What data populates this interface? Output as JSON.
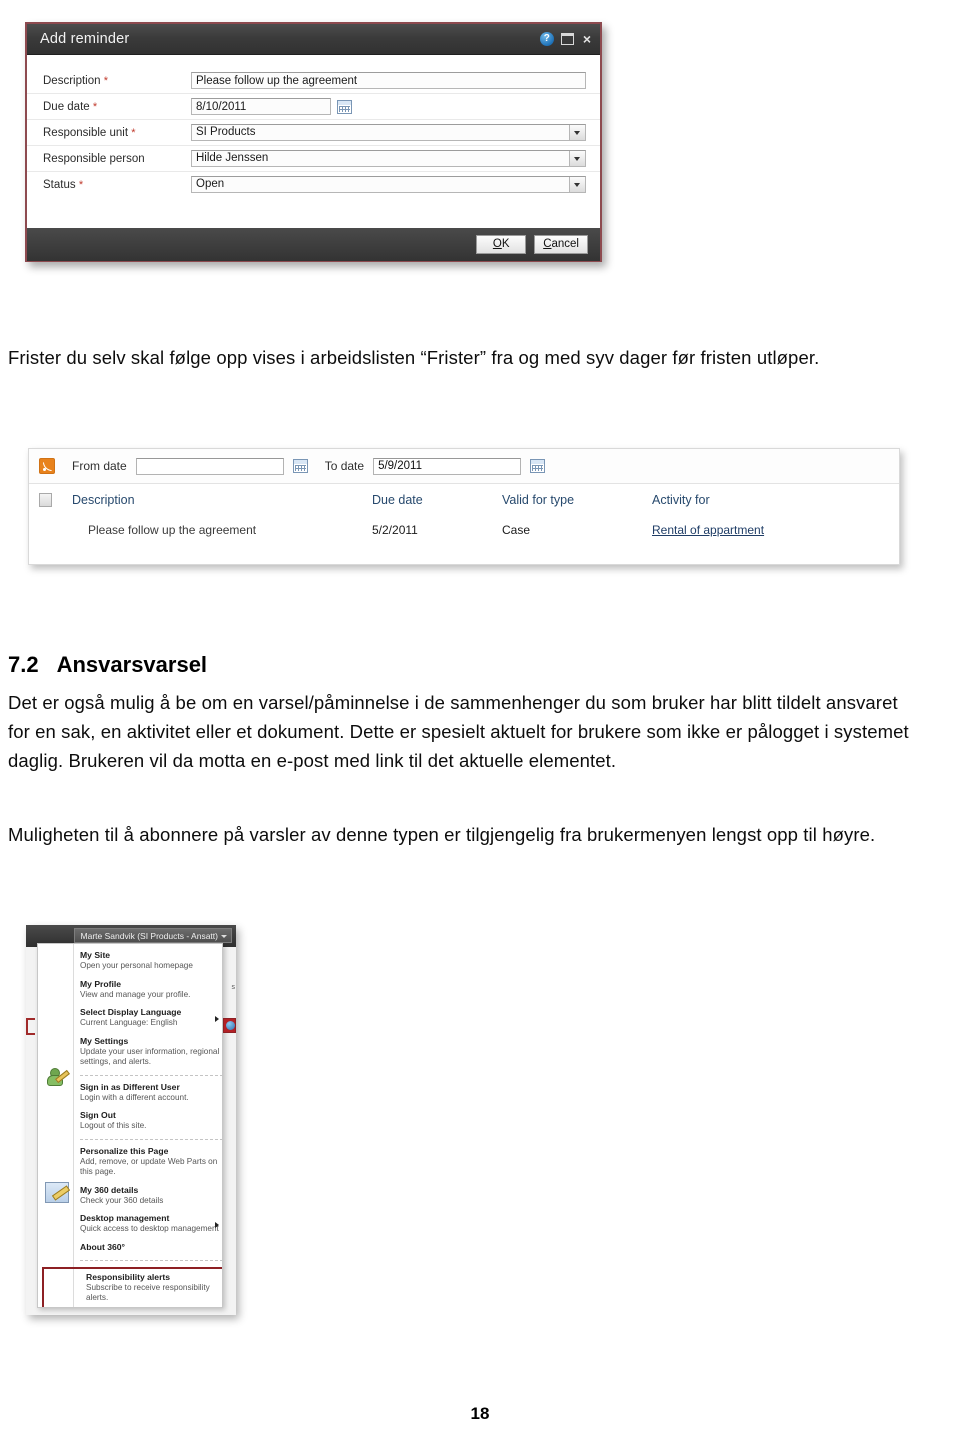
{
  "dialog": {
    "title": "Add reminder",
    "title_buttons": {
      "help": "?",
      "restore": "",
      "close": "×"
    },
    "fields": [
      {
        "label": "Description",
        "required": true,
        "value": "Please follow up the agreement",
        "control": "text"
      },
      {
        "label": "Due date",
        "required": true,
        "value": "8/10/2011",
        "control": "date"
      },
      {
        "label": "Responsible unit",
        "required": true,
        "value": "SI Products",
        "control": "combo"
      },
      {
        "label": "Responsible person",
        "required": false,
        "value": "Hilde Jenssen",
        "control": "combo"
      },
      {
        "label": "Status",
        "required": true,
        "value": "Open",
        "control": "combo"
      }
    ],
    "ok_label_pre": "O",
    "ok_label_accel": "K",
    "cancel_label_accel": "C",
    "cancel_label_post": "ancel"
  },
  "body_text": {
    "paragraph_1": "Frister du selv skal følge opp vises i arbeidslisten “Frister” fra og med syv dager før fristen utløper.",
    "section_number": "7.2",
    "section_title": "Ansvarsvarsel",
    "paragraph_2": "Det er også mulig å be om en varsel/påminnelse i de sammenhenger du som bruker har blitt tildelt ansvaret for en sak, en aktivitet eller et dokument. Dette er spesielt aktuelt for brukere som ikke er pålogget i systemet daglig. Brukeren vil da motta en e-post med link til det aktuelle elementet.",
    "paragraph_3": "Muligheten til å abonnere på varsler av denne typen er tilgjengelig fra brukermenyen lengst opp til høyre."
  },
  "reminder_list": {
    "filter": {
      "from_label": "From date",
      "from_value": "",
      "to_label": "To date",
      "to_value": "5/9/2011"
    },
    "columns": [
      "Description",
      "Due date",
      "Valid for type",
      "Activity for"
    ],
    "rows": [
      {
        "description": "Please follow up the agreement",
        "due_date": "5/2/2011",
        "valid_for_type": "Case",
        "activity_for": "Rental of appartment"
      }
    ]
  },
  "user_menu": {
    "user_button": "Marte Sandvik (SI Products - Ansatt)",
    "side_fragment": "s",
    "items": [
      {
        "title": "My Site",
        "desc": "Open your personal homepage",
        "arrow": false,
        "sep_before": false
      },
      {
        "title": "My Profile",
        "desc": "View and manage your profile.",
        "arrow": false,
        "sep_before": false
      },
      {
        "title": "Select Display Language",
        "desc": "Current Language: English",
        "arrow": true,
        "sep_before": false
      },
      {
        "title": "My Settings",
        "desc": "Update your user information, regional settings, and alerts.",
        "arrow": false,
        "sep_before": false
      },
      {
        "title": "Sign in as Different User",
        "desc": "Login with a different account.",
        "arrow": false,
        "sep_before": true
      },
      {
        "title": "Sign Out",
        "desc": "Logout of this site.",
        "arrow": false,
        "sep_before": false
      },
      {
        "title": "Personalize this Page",
        "desc": "Add, remove, or update Web Parts on this page.",
        "arrow": false,
        "sep_before": true
      },
      {
        "title": "My 360 details",
        "desc": "Check your 360 details",
        "arrow": false,
        "sep_before": false
      },
      {
        "title": "Desktop management",
        "desc": "Quick access to desktop management",
        "arrow": true,
        "sep_before": false
      },
      {
        "title": "About 360°",
        "desc": "",
        "arrow": false,
        "sep_before": false
      }
    ],
    "highlighted_item": {
      "title": "Responsibility alerts",
      "desc": "Subscribe to receive responsibility alerts.",
      "border_color": "#8d2024"
    }
  },
  "footer": {
    "page_number": "18"
  }
}
